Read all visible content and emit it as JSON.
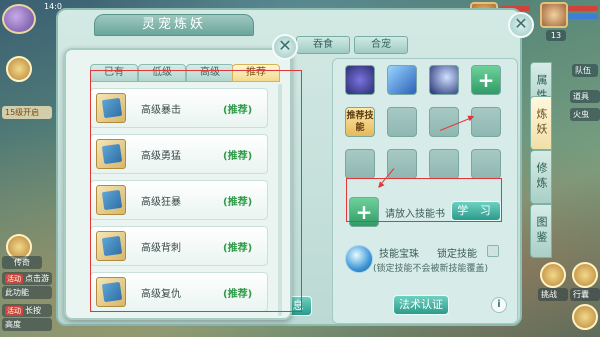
{
  "hud": {
    "time": "14:0",
    "level_hint": "15级开启",
    "chip_1_tag": "活动",
    "chip_1": "点击游",
    "chip_1b": "此功能",
    "chip_2_tag": "活动",
    "chip_2": "长按",
    "chip_2b": "高度",
    "left_label": "传奇",
    "right_labels": [
      "队伍",
      "道具",
      "火虫"
    ],
    "right_bottom": [
      "挑战",
      "行囊"
    ],
    "counter": "13"
  },
  "panel": {
    "title": "灵宠炼妖",
    "top_tabs": [
      "吞食",
      "合宠"
    ],
    "side_tabs": [
      "属性",
      "炼妖",
      "修炼",
      "图鉴"
    ],
    "active_side_tab": "炼妖",
    "recommend_slot": "推荐技能",
    "hint_put_book": "请放入技能书",
    "learn_button": "学 习",
    "skill_orb_label": "技能宝珠",
    "lock_label": "锁定技能",
    "lock_note": "(锁定技能不会被新技能覆盖)",
    "cert_button": "法术认证",
    "info": "i",
    "partial_button": "息"
  },
  "popup": {
    "tabs": [
      "已有",
      "低级",
      "高级",
      "推荐"
    ],
    "active_tab": "推荐",
    "items": [
      {
        "name": "高级暴击",
        "tag": "(推荐)"
      },
      {
        "name": "高级勇猛",
        "tag": "(推荐)"
      },
      {
        "name": "高级狂暴",
        "tag": "(推荐)"
      },
      {
        "name": "高级背刺",
        "tag": "(推荐)"
      },
      {
        "name": "高级复仇",
        "tag": "(推荐)"
      }
    ]
  },
  "colors": {
    "accent": "#2c9b8c",
    "recommend_tag": "#2f9a48",
    "annotation": "#e0383a"
  }
}
